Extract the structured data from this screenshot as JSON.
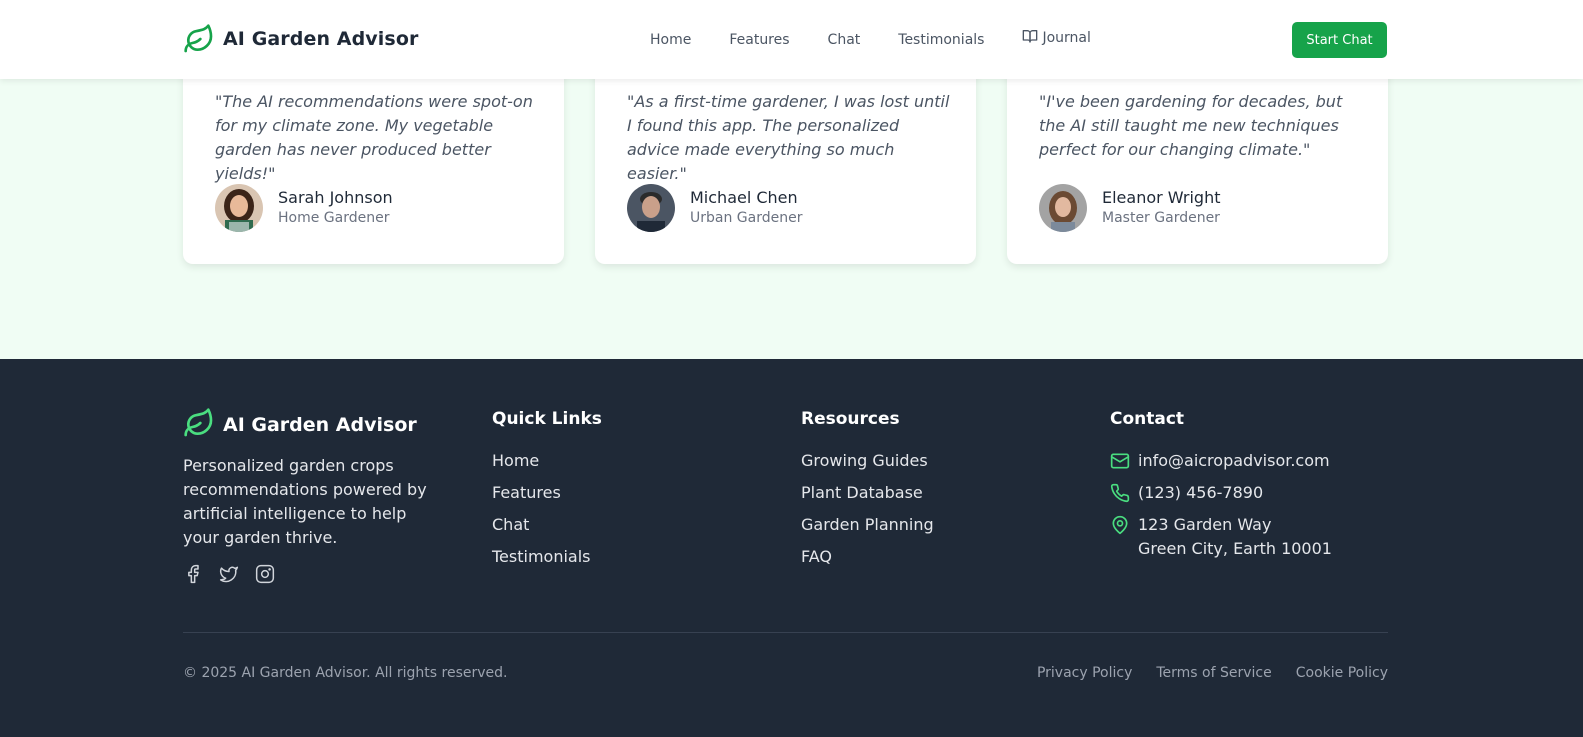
{
  "header": {
    "brand": "AI Garden Advisor",
    "nav": [
      "Home",
      "Features",
      "Chat",
      "Testimonials"
    ],
    "journal": "Journal",
    "cta": "Start Chat"
  },
  "testimonials": [
    {
      "quote": "\"The AI recommendations were spot-on for my climate zone. My vegetable garden has never produced better yields!\"",
      "name": "Sarah Johnson",
      "role": "Home Gardener"
    },
    {
      "quote": "\"As a first-time gardener, I was lost until I found this app. The personalized advice made everything so much easier.\"",
      "name": "Michael Chen",
      "role": "Urban Gardener"
    },
    {
      "quote": "\"I've been gardening for decades, but the AI still taught me new techniques perfect for our changing climate.\"",
      "name": "Eleanor Wright",
      "role": "Master Gardener"
    }
  ],
  "footer": {
    "brand": "AI Garden Advisor",
    "description": "Personalized garden crops recommendations powered by artificial intelligence to help your garden thrive.",
    "quick_links_title": "Quick Links",
    "quick_links": [
      "Home",
      "Features",
      "Chat",
      "Testimonials"
    ],
    "resources_title": "Resources",
    "resources": [
      "Growing Guides",
      "Plant Database",
      "Garden Planning",
      "FAQ"
    ],
    "contact_title": "Contact",
    "email": "info@aicropadvisor.com",
    "phone": "(123) 456-7890",
    "address_line1": "123 Garden Way",
    "address_line2": "Green City, Earth 10001",
    "copyright": "© 2025 AI Garden Advisor. All rights reserved.",
    "legal": [
      "Privacy Policy",
      "Terms of Service",
      "Cookie Policy"
    ]
  },
  "colors": {
    "accent": "#16a34a",
    "footer_bg": "#1f2937",
    "page_bg": "#f0fdf4"
  }
}
